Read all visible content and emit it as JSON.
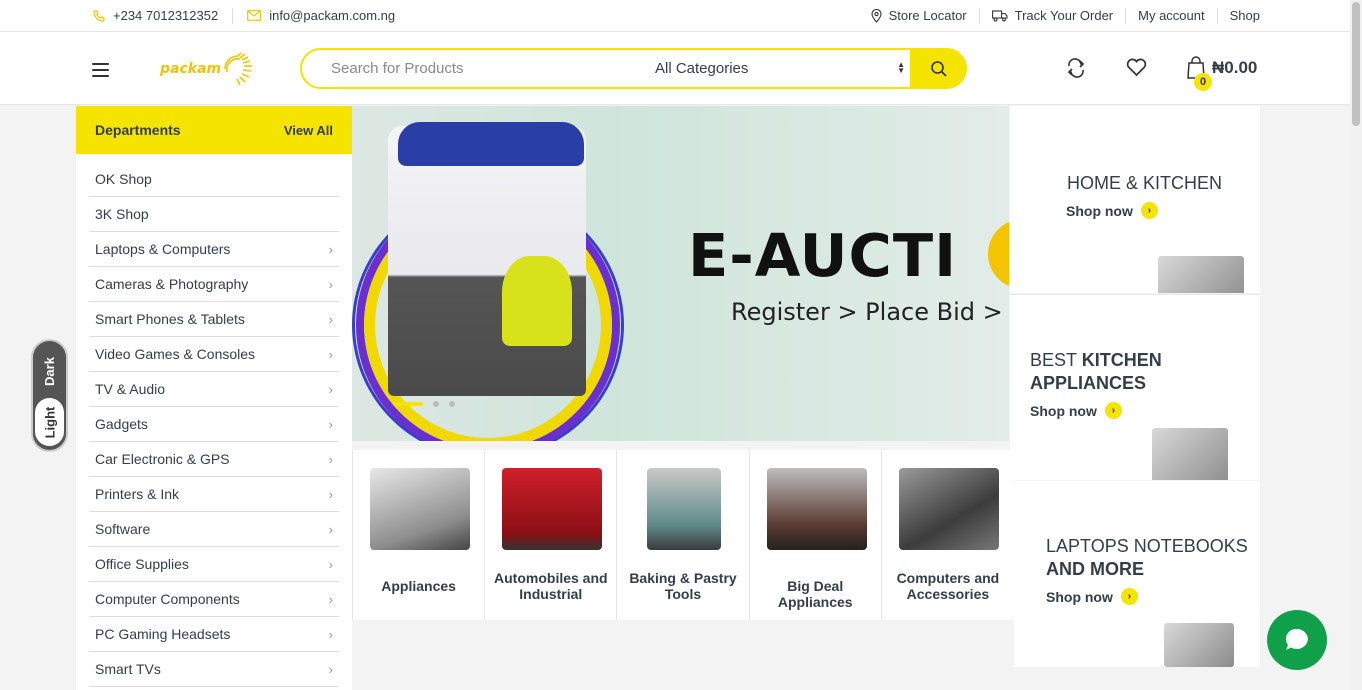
{
  "topbar": {
    "phone": "+234 7012312352",
    "email": "info@packam.com.ng",
    "links": [
      "Store Locator",
      "Track Your Order",
      "My account",
      "Shop"
    ]
  },
  "header": {
    "logo_text": "packam",
    "search": {
      "placeholder": "Search for Products",
      "category": "All Categories"
    },
    "cart": {
      "count": "0",
      "total": "₦0.00"
    }
  },
  "departments": {
    "title": "Departments",
    "view_all": "View All",
    "items": [
      {
        "label": "OK Shop",
        "has_sub": false
      },
      {
        "label": "3K Shop",
        "has_sub": false
      },
      {
        "label": "Laptops & Computers",
        "has_sub": true
      },
      {
        "label": "Cameras & Photography",
        "has_sub": true
      },
      {
        "label": "Smart Phones & Tablets",
        "has_sub": true
      },
      {
        "label": "Video Games & Consoles",
        "has_sub": true
      },
      {
        "label": "TV & Audio",
        "has_sub": true
      },
      {
        "label": "Gadgets",
        "has_sub": true
      },
      {
        "label": "Car Electronic & GPS",
        "has_sub": true
      },
      {
        "label": "Printers & Ink",
        "has_sub": true
      },
      {
        "label": "Software",
        "has_sub": true
      },
      {
        "label": "Office Supplies",
        "has_sub": true
      },
      {
        "label": "Computer Components",
        "has_sub": true
      },
      {
        "label": "PC Gaming Headsets",
        "has_sub": true
      },
      {
        "label": "Smart TVs",
        "has_sub": true
      }
    ]
  },
  "theme_toggle": {
    "dark": "Dark",
    "light": "Light"
  },
  "hero": {
    "headline": "E-AUCTI",
    "tagline": "Register > Place Bid > You",
    "slides": 3,
    "active_slide": 1
  },
  "side_banners": [
    {
      "line1": "HOME & KITCHEN",
      "line1_bold": "",
      "line2": "",
      "shop": "Shop now"
    },
    {
      "line1": "BEST ",
      "line1_bold": "KITCHEN",
      "line2": "APPLIANCES",
      "shop": "Shop now"
    },
    {
      "line1": "LAPTOPS NOTEBOOKS",
      "line1_bold": "",
      "line2": "AND MORE",
      "shop": "Shop now"
    }
  ],
  "categories": [
    {
      "line1": "Appliances",
      "line2": ""
    },
    {
      "line1": "Automobiles and",
      "line2": "Industrial"
    },
    {
      "line1": "Baking & Pastry",
      "line2": "Tools"
    },
    {
      "line1": "Big Deal Appliances",
      "line2": ""
    },
    {
      "line1": "Computers and",
      "line2": "Accessories"
    }
  ],
  "colors": {
    "accent": "#f5e400",
    "text": "#333e48",
    "chat": "#10a04a"
  }
}
